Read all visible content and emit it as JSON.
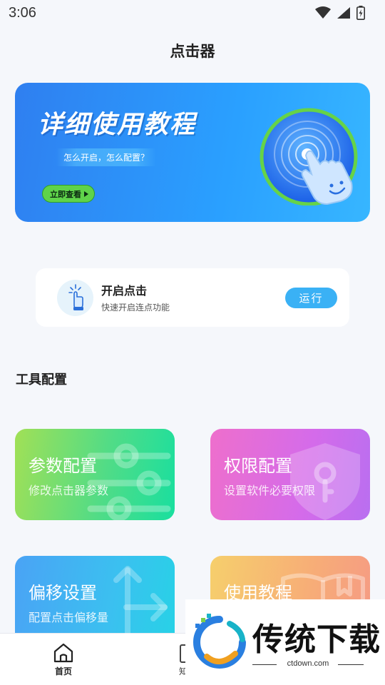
{
  "status_bar": {
    "time": "3:06"
  },
  "header": {
    "title": "点击器"
  },
  "banner": {
    "title": "详细使用教程",
    "subtitle": "怎么开启，怎么配置？",
    "button_label": "立即查看"
  },
  "run_card": {
    "title": "开启点击",
    "subtitle": "快速开启连点功能",
    "button_label": "运行"
  },
  "tools_section": {
    "title": "工具配置",
    "cards": [
      {
        "title": "参数配置",
        "subtitle": "修改点击器参数"
      },
      {
        "title": "权限配置",
        "subtitle": "设置软件必要权限"
      },
      {
        "title": "偏移设置",
        "subtitle": "配置点击偏移量"
      },
      {
        "title": "使用教程",
        "subtitle": ""
      }
    ]
  },
  "bottom_nav": {
    "items": [
      {
        "label": "首页",
        "icon": "home-icon",
        "active": true
      },
      {
        "label": "知",
        "icon": "document-icon",
        "active": false
      }
    ]
  },
  "watermark": {
    "brand": "传统下载",
    "url": "ctdown.com"
  },
  "colors": {
    "banner": "#2a9bff",
    "run_button": "#3ab1f5",
    "accent_green": "#5fd34a"
  }
}
